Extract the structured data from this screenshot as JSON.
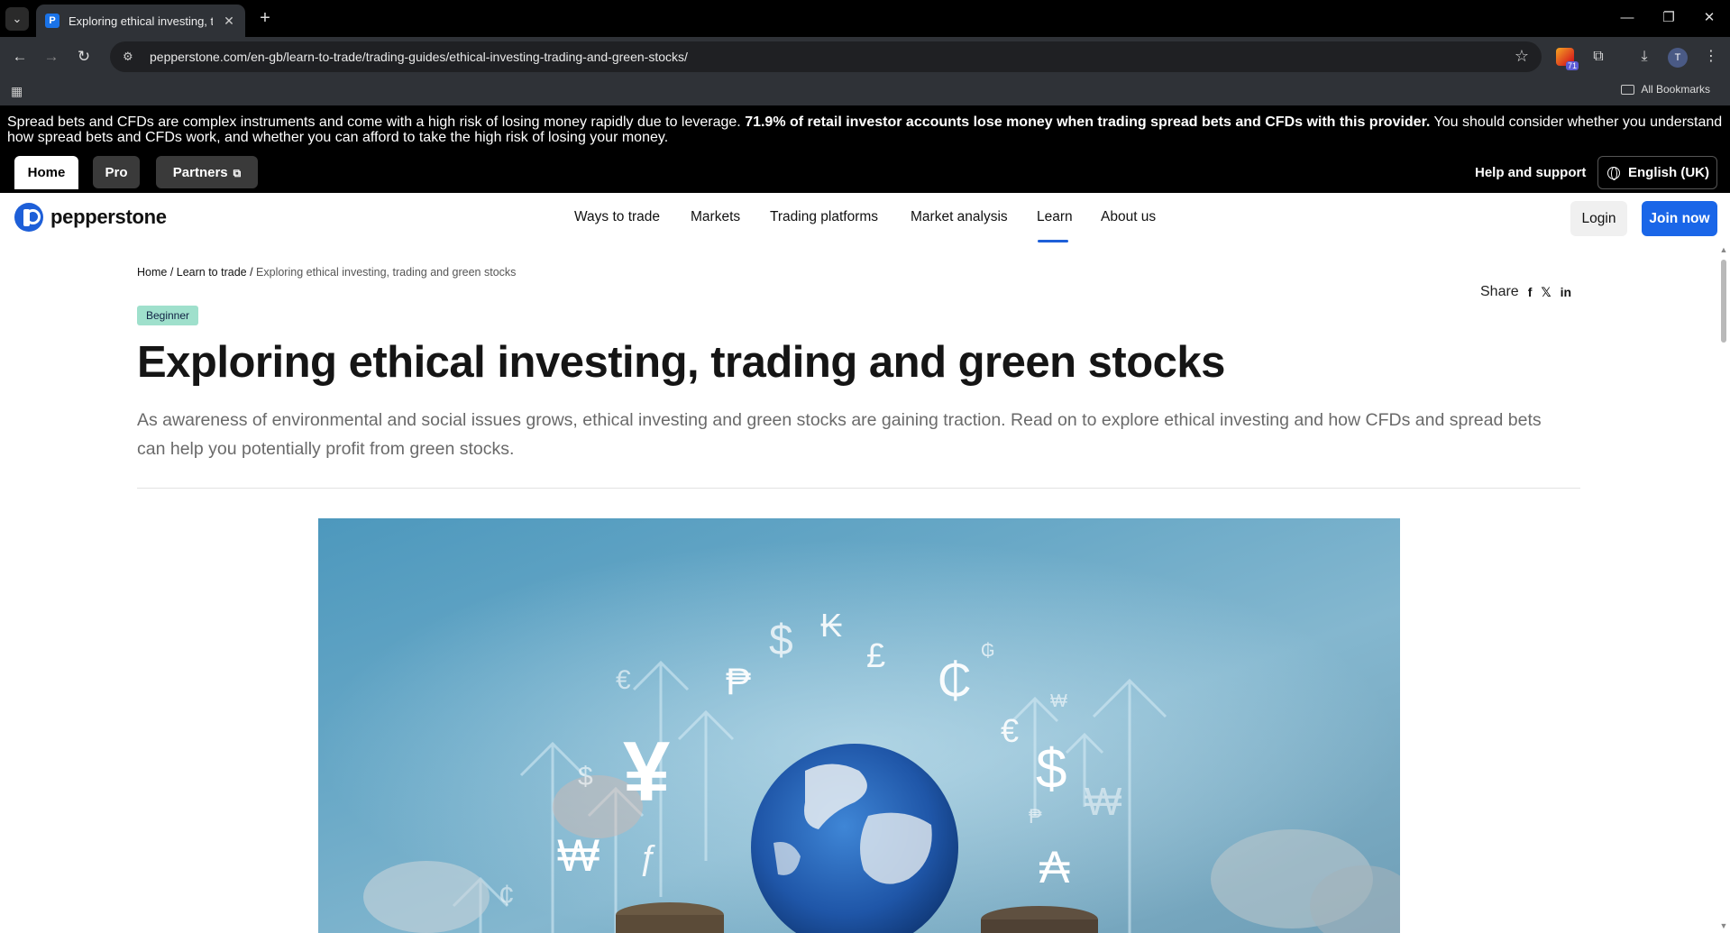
{
  "browser": {
    "tab_title": "Exploring ethical investing, trad",
    "url": "pepperstone.com/en-gb/learn-to-trade/trading-guides/ethical-investing-trading-and-green-stocks/",
    "all_bookmarks_label": "All Bookmarks",
    "extension_badge_count": "71",
    "profile_initial": "T"
  },
  "risk_warning": {
    "part1": "Spread bets and CFDs are complex instruments and come with a high risk of losing money rapidly due to leverage. ",
    "bold": "71.9% of retail investor accounts lose money when trading spread bets and CFDs with this provider.",
    "part2": " You should consider whether you understand how spread bets and CFDs work, and whether you can afford to take the high risk of losing your money."
  },
  "topbar": {
    "tabs": [
      {
        "label": "Home"
      },
      {
        "label": "Pro"
      },
      {
        "label": "Partners"
      }
    ],
    "help_label": "Help and support",
    "language_label": "English (UK)"
  },
  "nav": {
    "logo_text": "pepperstone",
    "links": [
      {
        "label": "Ways to trade"
      },
      {
        "label": "Markets"
      },
      {
        "label": "Trading platforms"
      },
      {
        "label": "Market analysis"
      },
      {
        "label": "Learn"
      },
      {
        "label": "About us"
      }
    ],
    "login_label": "Login",
    "join_label": "Join now"
  },
  "article": {
    "breadcrumb": {
      "home": "Home",
      "learn": "Learn to trade",
      "separator": " / ",
      "current": "Exploring ethical investing, trading and green stocks"
    },
    "share_label": "Share",
    "share_icons": {
      "facebook": "f",
      "twitter": "𝕏",
      "linkedin": "in"
    },
    "level": "Beginner",
    "title": "Exploring ethical investing, trading and green stocks",
    "lede": "As awareness of environmental and social issues grows, ethical investing and green stocks are gaining traction. Read on to explore ethical investing and how CFDs and spread bets can help you potentially profit from green stocks."
  },
  "hero": {
    "currency_symbols": [
      "$",
      "₭",
      "£",
      "₲",
      "€",
      "₱",
      "₵",
      "₩",
      "¥",
      "€",
      "$",
      "$",
      "₱",
      "₩",
      "₩",
      "ƒ",
      "₳",
      "¢"
    ]
  }
}
